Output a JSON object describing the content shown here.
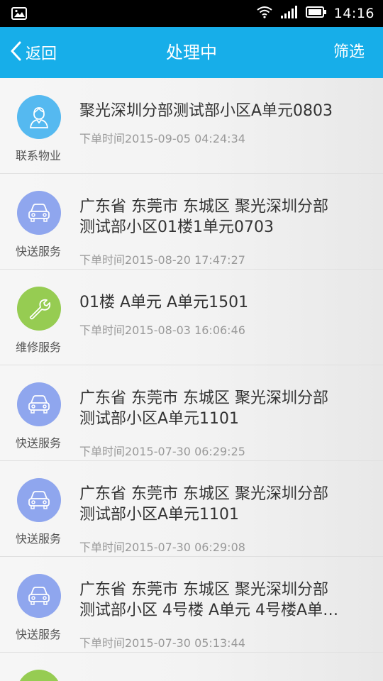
{
  "status": {
    "time": "14:16"
  },
  "nav": {
    "back_label": "返回",
    "title": "处理中",
    "filter_label": "筛选"
  },
  "colors": {
    "accent": "#17aee9",
    "person": "#55b9f0",
    "delivery": "#8fa6ee",
    "repair": "#96cc52"
  },
  "orders": [
    {
      "type": "联系物业",
      "icon": "person-icon",
      "address": "聚光深圳分部测试部小区A单元0803",
      "date": "下单时间2015-09-05 04:24:34"
    },
    {
      "type": "快送服务",
      "icon": "car-icon",
      "address": "广东省 东莞市 东城区 聚光深圳分部\n测试部小区01楼1单元0703",
      "date": "下单时间2015-08-20 17:47:27"
    },
    {
      "type": "维修服务",
      "icon": "wrench-icon",
      "address": " 01楼 A单元 A单元1501",
      "date": "下单时间2015-08-03 16:06:46"
    },
    {
      "type": "快送服务",
      "icon": "car-icon",
      "address": "广东省 东莞市 东城区 聚光深圳分部\n测试部小区A单元1101",
      "date": "下单时间2015-07-30 06:29:25"
    },
    {
      "type": "快送服务",
      "icon": "car-icon",
      "address": "广东省 东莞市 东城区 聚光深圳分部\n测试部小区A单元1101",
      "date": "下单时间2015-07-30 06:29:08"
    },
    {
      "type": "快送服务",
      "icon": "car-icon",
      "address": "广东省 东莞市 东城区 聚光深圳分部\n测试部小区 4号楼 A单元 4号楼A单…",
      "date": "下单时间2015-07-30 05:13:44"
    }
  ]
}
